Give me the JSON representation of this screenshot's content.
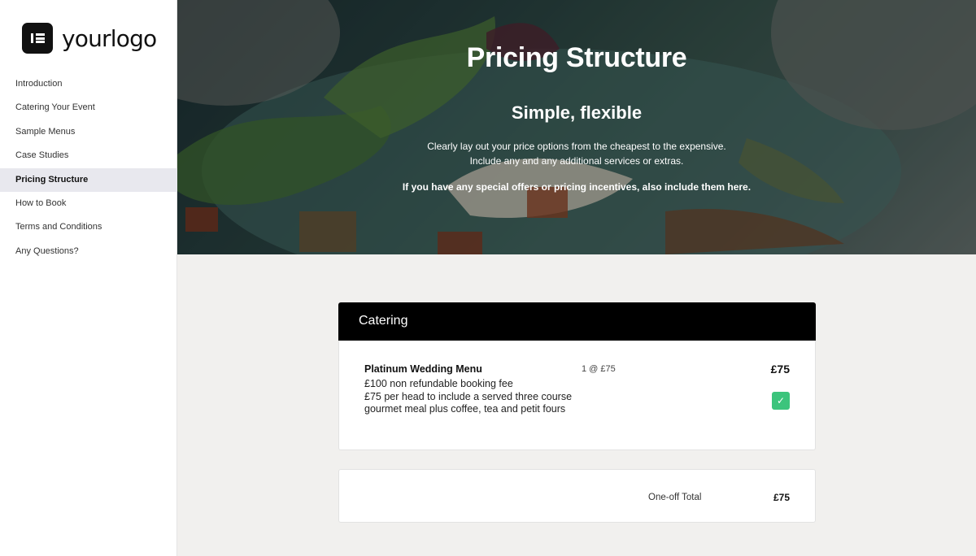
{
  "brand": {
    "logo_text": "yourlogo"
  },
  "sidebar": {
    "items": [
      {
        "label": "Introduction",
        "active": false
      },
      {
        "label": "Catering Your Event",
        "active": false
      },
      {
        "label": "Sample Menus",
        "active": false
      },
      {
        "label": "Case Studies",
        "active": false
      },
      {
        "label": "Pricing Structure",
        "active": true
      },
      {
        "label": "How to Book",
        "active": false
      },
      {
        "label": "Terms and Conditions",
        "active": false
      },
      {
        "label": "Any Questions?",
        "active": false
      }
    ]
  },
  "hero": {
    "title": "Pricing Structure",
    "subtitle": "Simple, flexible",
    "line1": "Clearly lay out your price options from the cheapest to the expensive.",
    "line2": "Include any and any additional services or extras.",
    "line3": "If you have any special offers or pricing incentives, also include them here."
  },
  "pricing": {
    "section_title": "Catering",
    "item": {
      "name": "Platinum Wedding Menu",
      "description": "£100 non refundable booking fee\n£75 per head to include a served three course gourmet meal plus coffee, tea and petit fours",
      "quantity": "1 @ £75",
      "price": "£75",
      "selected": true,
      "check_icon": "checkmark-icon"
    },
    "total_label": "One-off Total",
    "total_value": "£75"
  },
  "colors": {
    "check_green": "#3cc47c",
    "active_nav_bg": "#e8e8ee",
    "header_black": "#000000"
  }
}
